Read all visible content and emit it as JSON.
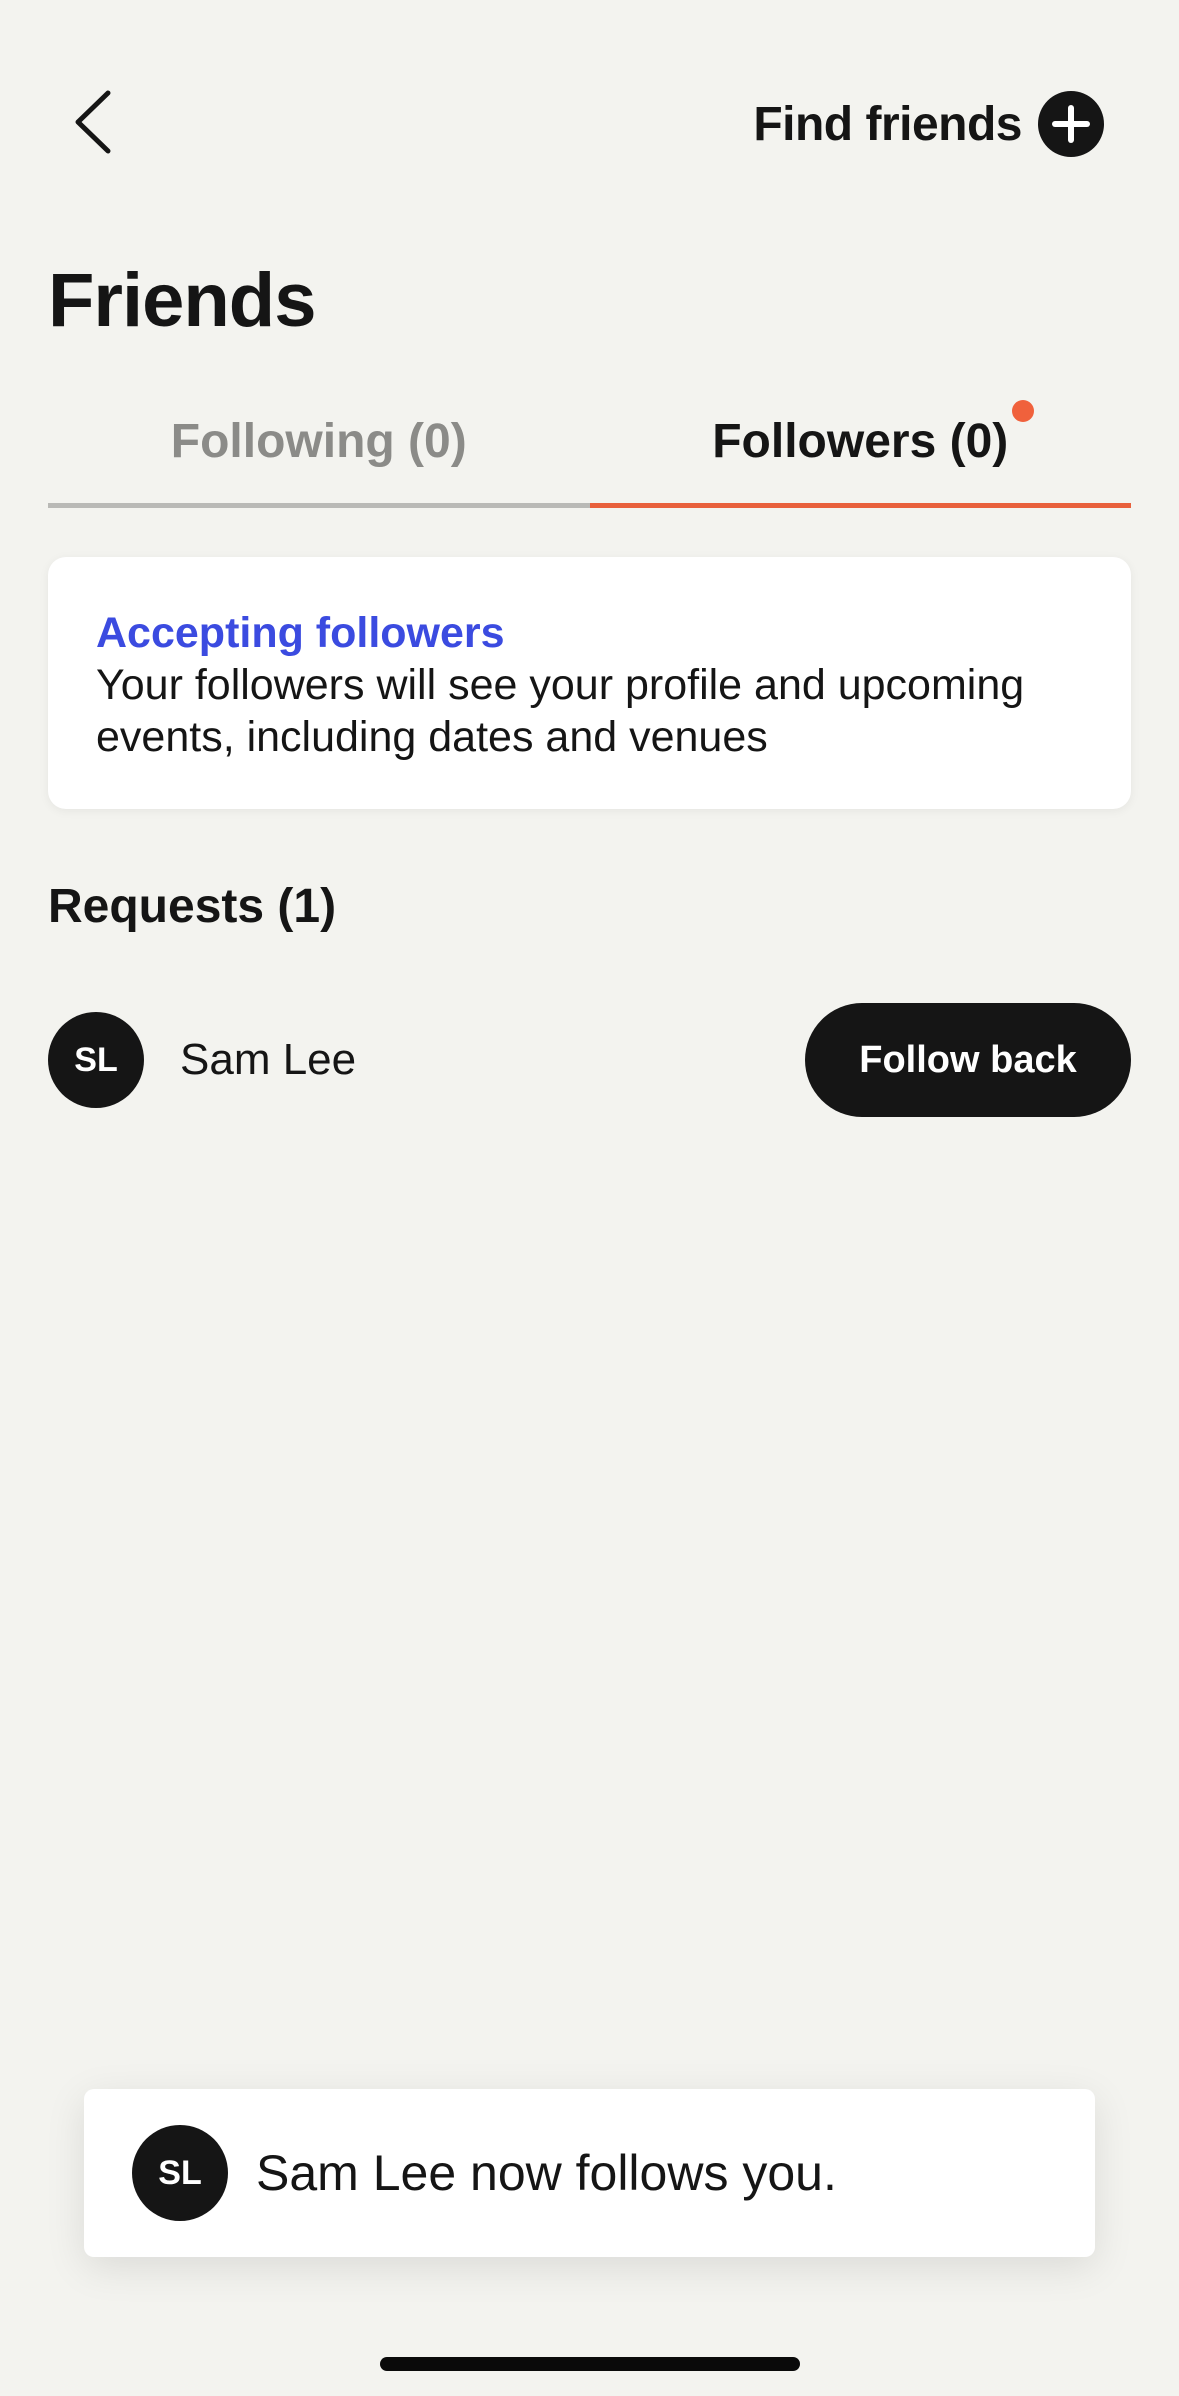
{
  "header": {
    "back_icon": "chevron-left-icon",
    "find_friends_label": "Find friends",
    "find_friends_icon": "plus-circle-icon"
  },
  "page": {
    "title": "Friends"
  },
  "tabs": [
    {
      "label": "Following (0)",
      "active": false
    },
    {
      "label": "Followers (0)",
      "active": true,
      "has_notification": true
    }
  ],
  "info_card": {
    "title": "Accepting followers",
    "body": "Your followers will see your profile and upcoming events, including dates and venues"
  },
  "requests": {
    "heading": "Requests (1)",
    "items": [
      {
        "initials": "SL",
        "name": "Sam Lee",
        "action_label": "Follow back"
      }
    ]
  },
  "toast": {
    "initials": "SL",
    "message": "Sam Lee now follows you."
  },
  "colors": {
    "background": "#f3f3ef",
    "accent": "#e8603c",
    "link_blue": "#3b4be0",
    "dark": "#151515"
  }
}
